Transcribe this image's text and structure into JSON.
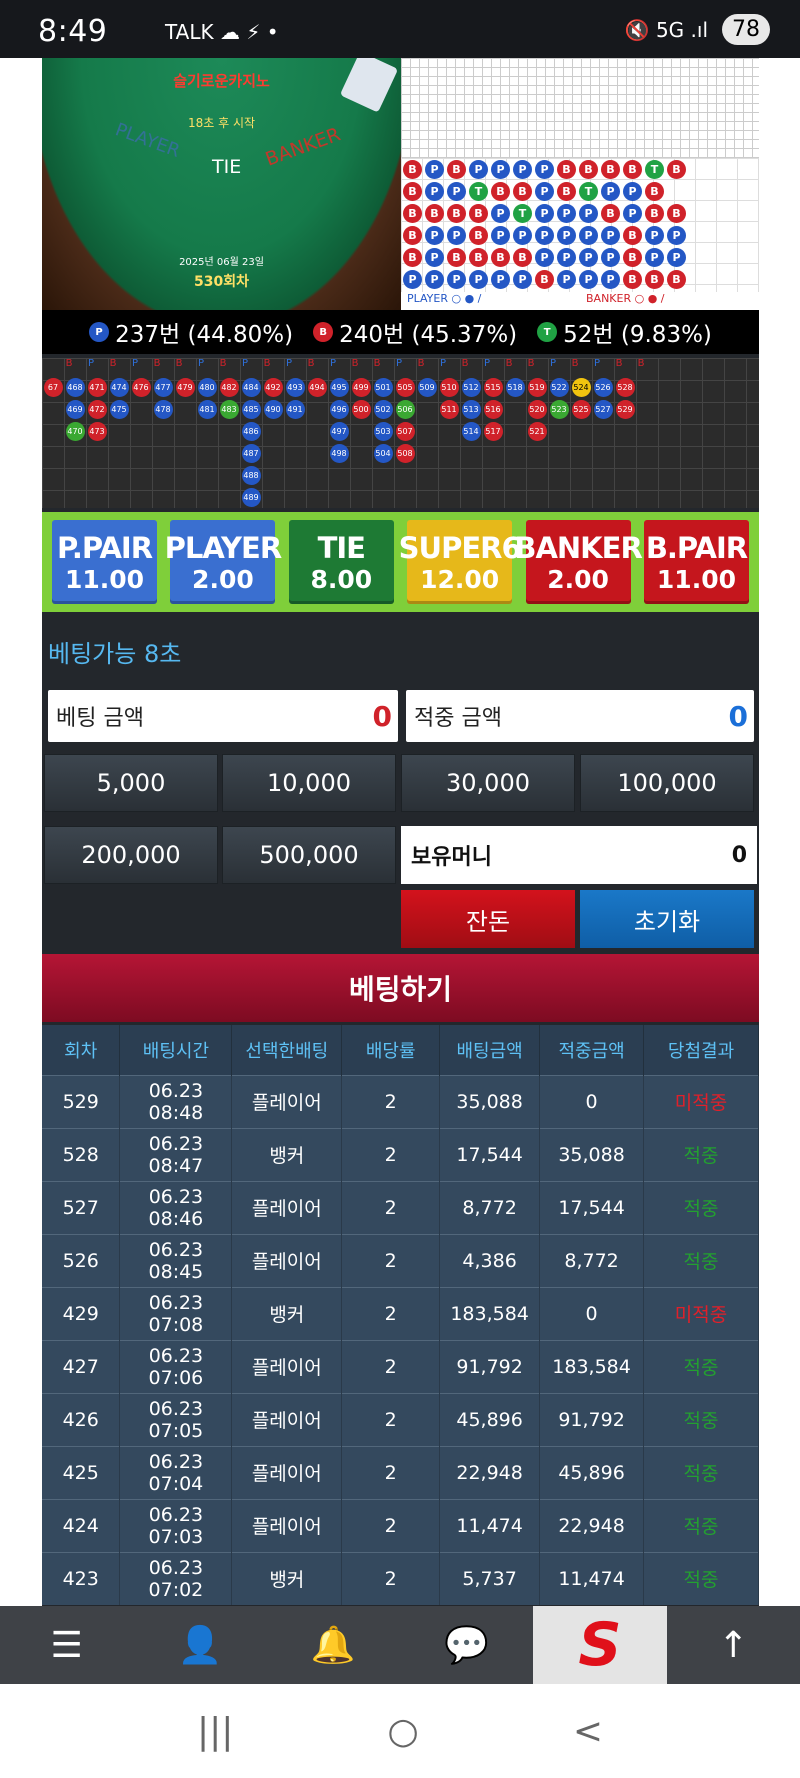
{
  "statusbar": {
    "time": "8:49",
    "notif_icons": "TALK ☁ ⚡ •",
    "right_icons": "🔇 5G .ıl",
    "battery": "78"
  },
  "game": {
    "logo": "슬기로운카지노",
    "timer": "18초 후 시작",
    "player": "PLAYER",
    "tie": "TIE",
    "banker": "BANKER",
    "date": "2025년 06월 23일",
    "round": "530회차",
    "bead_rows": [
      [
        "B",
        "P",
        "B",
        "P",
        "P",
        "P",
        "P",
        "B",
        "B",
        "B",
        "B",
        "T",
        "B"
      ],
      [
        "B",
        "P",
        "P",
        "T",
        "B",
        "B",
        "P",
        "B",
        "T",
        "P",
        "P",
        "B"
      ],
      [
        "B",
        "B",
        "B",
        "B",
        "P",
        "T",
        "P",
        "P",
        "P",
        "B",
        "P",
        "B",
        "B"
      ],
      [
        "B",
        "P",
        "P",
        "B",
        "P",
        "P",
        "P",
        "P",
        "P",
        "P",
        "B",
        "P",
        "P"
      ],
      [
        "B",
        "P",
        "B",
        "B",
        "B",
        "B",
        "P",
        "P",
        "P",
        "P",
        "B",
        "P",
        "P"
      ],
      [
        "P",
        "P",
        "P",
        "P",
        "P",
        "P",
        "B",
        "P",
        "P",
        "P",
        "B",
        "B",
        "B"
      ]
    ],
    "legend_player": "PLAYER ○ ● /",
    "legend_banker": "BANKER ○ ● /"
  },
  "stats": {
    "player": "237번 (44.80%)",
    "banker": "240번 (45.37%)",
    "tie": "52번 (9.83%)",
    "p": "P",
    "b": "B",
    "t": "T"
  },
  "history_header": [
    "B",
    "P",
    "B",
    "P",
    "B",
    "B",
    "P",
    "B",
    "P",
    "B",
    "P",
    "B",
    "P",
    "B",
    "B",
    "P",
    "B",
    "P",
    "B",
    "P",
    "B",
    "B",
    "P",
    "B",
    "P",
    "B",
    "B"
  ],
  "history_cols": [
    [
      {
        "n": "67",
        "c": "B"
      }
    ],
    [
      {
        "n": "468",
        "c": "P"
      },
      {
        "n": "469",
        "c": "P"
      },
      {
        "n": "470",
        "c": "T"
      }
    ],
    [
      {
        "n": "471",
        "c": "B"
      },
      {
        "n": "472",
        "c": "B"
      },
      {
        "n": "473",
        "c": "B"
      }
    ],
    [
      {
        "n": "474",
        "c": "P"
      },
      {
        "n": "475",
        "c": "P"
      }
    ],
    [
      {
        "n": "476",
        "c": "B"
      }
    ],
    [
      {
        "n": "477",
        "c": "P"
      },
      {
        "n": "478",
        "c": "P"
      }
    ],
    [
      {
        "n": "479",
        "c": "B"
      }
    ],
    [
      {
        "n": "480",
        "c": "P"
      },
      {
        "n": "481",
        "c": "P"
      }
    ],
    [
      {
        "n": "482",
        "c": "B"
      },
      {
        "n": "483",
        "c": "T"
      }
    ],
    [
      {
        "n": "484",
        "c": "P"
      },
      {
        "n": "485",
        "c": "P"
      },
      {
        "n": "486",
        "c": "P"
      },
      {
        "n": "487",
        "c": "P"
      },
      {
        "n": "488",
        "c": "P"
      },
      {
        "n": "489",
        "c": "P"
      }
    ],
    [
      {
        "n": "492",
        "c": "B"
      },
      {
        "n": "490",
        "c": "P"
      }
    ],
    [
      {
        "n": "493",
        "c": "P"
      },
      {
        "n": "491",
        "c": "P"
      }
    ],
    [
      {
        "n": "494",
        "c": "B"
      }
    ],
    [
      {
        "n": "495",
        "c": "P"
      },
      {
        "n": "496",
        "c": "P"
      },
      {
        "n": "497",
        "c": "P"
      },
      {
        "n": "498",
        "c": "P"
      }
    ],
    [
      {
        "n": "499",
        "c": "B"
      },
      {
        "n": "500",
        "c": "B"
      }
    ],
    [
      {
        "n": "501",
        "c": "P"
      },
      {
        "n": "502",
        "c": "P"
      },
      {
        "n": "503",
        "c": "P"
      },
      {
        "n": "504",
        "c": "P"
      }
    ],
    [
      {
        "n": "505",
        "c": "B"
      },
      {
        "n": "506",
        "c": "T"
      },
      {
        "n": "507",
        "c": "B"
      },
      {
        "n": "508",
        "c": "B"
      }
    ],
    [
      {
        "n": "509",
        "c": "P"
      }
    ],
    [
      {
        "n": "510",
        "c": "B"
      },
      {
        "n": "511",
        "c": "B"
      }
    ],
    [
      {
        "n": "512",
        "c": "P"
      },
      {
        "n": "513",
        "c": "P"
      },
      {
        "n": "514",
        "c": "P"
      }
    ],
    [
      {
        "n": "515",
        "c": "B"
      },
      {
        "n": "516",
        "c": "B"
      },
      {
        "n": "517",
        "c": "B"
      }
    ],
    [
      {
        "n": "518",
        "c": "P"
      }
    ],
    [
      {
        "n": "519",
        "c": "B"
      },
      {
        "n": "520",
        "c": "B"
      },
      {
        "n": "521",
        "c": "B"
      }
    ],
    [
      {
        "n": "522",
        "c": "P"
      },
      {
        "n": "523",
        "c": "T"
      }
    ],
    [
      {
        "n": "524",
        "c": "Y"
      },
      {
        "n": "525",
        "c": "B"
      }
    ],
    [
      {
        "n": "526",
        "c": "P"
      },
      {
        "n": "527",
        "c": "P"
      }
    ],
    [
      {
        "n": "528",
        "c": "B"
      },
      {
        "n": "529",
        "c": "B"
      }
    ]
  ],
  "odds": [
    {
      "name": "P.PAIR",
      "odds": "11.00",
      "color": "#3a6fd0"
    },
    {
      "name": "PLAYER",
      "odds": "2.00",
      "color": "#3a6fd0"
    },
    {
      "name": "TIE",
      "odds": "8.00",
      "color": "#1e7a34"
    },
    {
      "name": "SUPER6",
      "odds": "12.00",
      "color": "#e6b81a"
    },
    {
      "name": "BANKER",
      "odds": "2.00",
      "color": "#c5161d"
    },
    {
      "name": "B.PAIR",
      "odds": "11.00",
      "color": "#c5161d"
    }
  ],
  "betting": {
    "time_label": "베팅가능 8초",
    "bet_amount_label": "베팅 금액",
    "bet_amount_value": "0",
    "win_amount_label": "적중 금액",
    "win_amount_value": "0",
    "chips": [
      "5,000",
      "10,000",
      "30,000",
      "100,000",
      "200,000",
      "500,000"
    ],
    "money_label": "보유머니",
    "money_value": "0",
    "balance_btn": "잔돈",
    "reset_btn": "초기화",
    "submit": "베팅하기"
  },
  "bet_table": {
    "headers": [
      "회차",
      "배팅시간",
      "선택한배팅",
      "배당률",
      "배팅금액",
      "적중금액",
      "당첨결과"
    ],
    "rows": [
      [
        "529",
        "06.23 08:48",
        "플레이어",
        "2",
        "35,088",
        "0",
        "미적중",
        "lose"
      ],
      [
        "528",
        "06.23 08:47",
        "뱅커",
        "2",
        "17,544",
        "35,088",
        "적중",
        "win"
      ],
      [
        "527",
        "06.23 08:46",
        "플레이어",
        "2",
        "8,772",
        "17,544",
        "적중",
        "win"
      ],
      [
        "526",
        "06.23 08:45",
        "플레이어",
        "2",
        "4,386",
        "8,772",
        "적중",
        "win"
      ],
      [
        "429",
        "06.23 07:08",
        "뱅커",
        "2",
        "183,584",
        "0",
        "미적중",
        "lose"
      ],
      [
        "427",
        "06.23 07:06",
        "플레이어",
        "2",
        "91,792",
        "183,584",
        "적중",
        "win"
      ],
      [
        "426",
        "06.23 07:05",
        "플레이어",
        "2",
        "45,896",
        "91,792",
        "적중",
        "win"
      ],
      [
        "425",
        "06.23 07:04",
        "플레이어",
        "2",
        "22,948",
        "45,896",
        "적중",
        "win"
      ],
      [
        "424",
        "06.23 07:03",
        "플레이어",
        "2",
        "11,474",
        "22,948",
        "적중",
        "win"
      ],
      [
        "423",
        "06.23 07:02",
        "뱅커",
        "2",
        "5,737",
        "11,474",
        "적중",
        "win"
      ]
    ]
  },
  "nav": {
    "menu": "☰",
    "user": "👤",
    "bell": "🔔",
    "chat": "💬",
    "logo": "S",
    "up": "↑"
  },
  "sysnav": {
    "recent": "|||",
    "home": "○",
    "back": "<"
  }
}
